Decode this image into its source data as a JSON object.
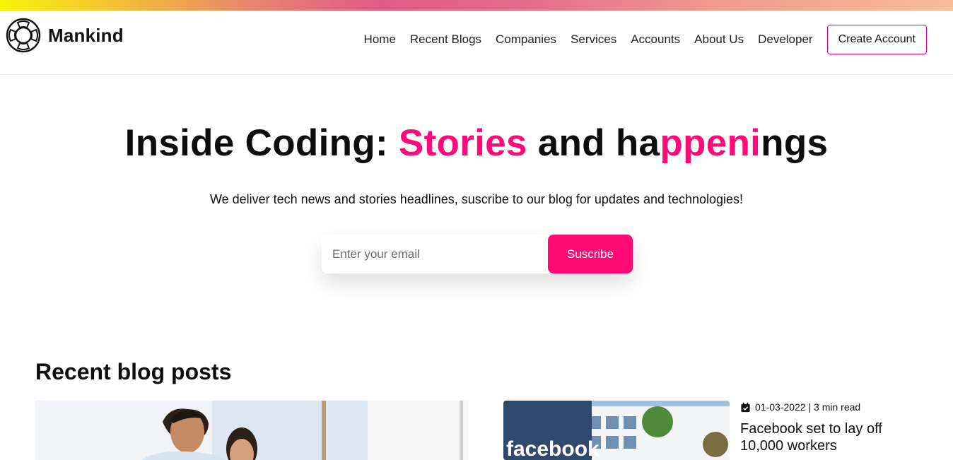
{
  "brand": {
    "name": "Mankind",
    "logo_icon": "lifebuoy-icon"
  },
  "nav": {
    "links": [
      "Home",
      "Recent Blogs",
      "Companies",
      "Services",
      "Accounts",
      "About Us",
      "Developer"
    ],
    "cta_label": "Create Account"
  },
  "hero": {
    "title_parts": [
      "Inside Coding: ",
      "Stories",
      " and ha",
      "ppeni",
      "ngs"
    ],
    "subtitle": "We deliver tech news and stories headlines, suscribe to our blog for updates and technologies!",
    "email_placeholder": "Enter your email",
    "subscribe_label": "Suscribe"
  },
  "recent": {
    "section_title": "Recent blog posts",
    "posts": [
      {
        "image": "office-people-image",
        "date": "",
        "read_time": "",
        "title": ""
      },
      {
        "image": "facebook-building-image",
        "image_text": "facebook",
        "date_read": "01-03-2022 | 3 min read",
        "title": "Facebook set to lay off 10,000 workers"
      }
    ]
  },
  "colors": {
    "accent": "#ff0a78",
    "border_cta": "#e0007a"
  }
}
